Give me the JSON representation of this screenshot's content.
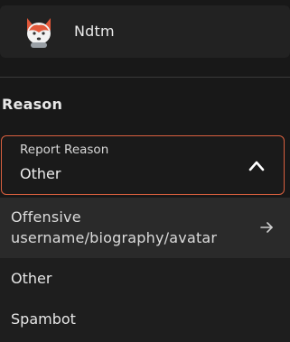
{
  "user": {
    "name": "Ndtm"
  },
  "section": {
    "title": "Reason"
  },
  "select": {
    "label": "Report Reason",
    "value": "Other"
  },
  "options": [
    {
      "line1": "Offensive",
      "line2": "username/biography/avatar",
      "icon": "arrow-right-icon"
    },
    {
      "label": "Other"
    },
    {
      "label": "Spambot"
    }
  ],
  "colors": {
    "accent_border": "#d9603f",
    "background": "#181818",
    "hover_row": "#2a2a2a"
  }
}
